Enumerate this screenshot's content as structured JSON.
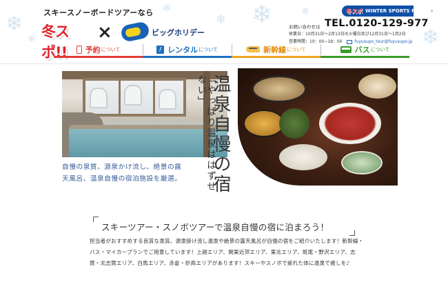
{
  "header": {
    "tagline": "スキースノーボードツアーなら",
    "logo_fuyu": "冬スポ!!",
    "cross": "×",
    "logo_bh_name": "ビッグホリデー",
    "festa_logo": "冬スポ",
    "festa_text": "WINTER SPORTS FESTA",
    "festa_arrow": "›",
    "contact_label": "お問い合わせは",
    "tel": "TEL.0120-129-977",
    "hours1": "休業日：10月31日〜2月13日の火曜日及び12月31日〜1月2日",
    "hours2_label": "営業時間：10：00−18：00",
    "email": "fuyusupo_tour@fuyusupo.jp"
  },
  "nav": [
    {
      "label": "予約",
      "sub": "について",
      "icon": "phone-icon"
    },
    {
      "label": "レンタル",
      "sub": "について",
      "icon": "rental-icon"
    },
    {
      "label": "新幹線",
      "sub": "について",
      "icon": "train-icon"
    },
    {
      "label": "バス",
      "sub": "について",
      "icon": "bus-icon"
    }
  ],
  "hero": {
    "sub_title": "「やっぱり温泉ははずせない」",
    "main_title": "温泉自慢の宿",
    "desc_line1": "自慢の泉質、源泉かけ流し、絶景の露",
    "desc_line2": "天風呂、温泉自慢の宿泊施設を厳選。"
  },
  "intro": {
    "heading": "スキーツアー・スノボツアーで温泉自慢の宿に泊まろう！",
    "body": "担当者がおすすめする良質な泉質、源泉掛け流し温泉や絶景の露天風呂が自慢の宿をご紹介いたします！新幹線・バス・マイカープランでご用意しています！上越エリア、関東近郊エリア、東北エリア、斑尾・野沢エリア、志賀・北志賀エリア、白馬エリア、赤倉・妙高エリアがあります！スキーやスノボで疲れた体に温泉で癒しを♪"
  },
  "colors": {
    "yoyaku": "#e53935",
    "rental": "#1e6fc3",
    "shinkansen": "#f0a21d",
    "bus": "#3a9b2a",
    "desc_text": "#3a5d9c"
  }
}
